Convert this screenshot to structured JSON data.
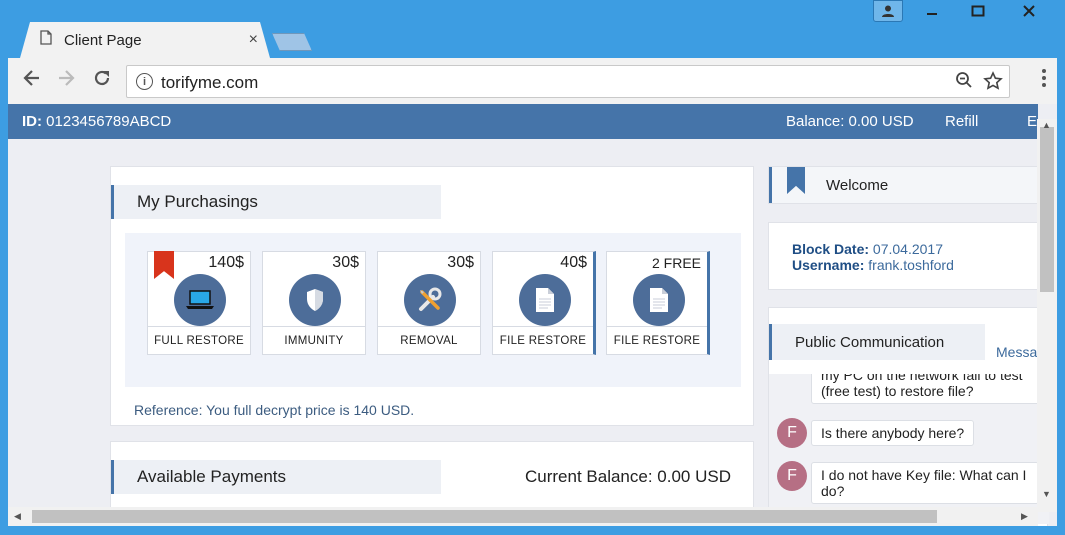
{
  "browser": {
    "tab_title": "Client Page",
    "tab_close": "×",
    "url": "torifyme.com",
    "icons": {
      "back": "back-arrow-icon",
      "forward": "forward-arrow-icon",
      "reload": "reload-icon",
      "info": "info-icon",
      "zoom": "zoom-out-icon",
      "star": "bookmark-star-icon",
      "menu": "kebab-menu-icon"
    }
  },
  "topbar": {
    "id_label": "ID:",
    "id_value": "0123456789ABCD",
    "balance": "Balance: 0.00 USD",
    "refill": "Refill",
    "more": "E"
  },
  "purchasings": {
    "title": "My Purchasings",
    "products": [
      {
        "price": "140$",
        "label": "FULL RESTORE",
        "icon": "laptop-icon"
      },
      {
        "price": "30$",
        "label": "IMMUNITY",
        "icon": "shield-icon"
      },
      {
        "price": "30$",
        "label": "REMOVAL",
        "icon": "tools-icon"
      },
      {
        "price": "40$",
        "label": "FILE RESTORE",
        "icon": "file-icon"
      },
      {
        "price": "2 FREE",
        "label": "FILE RESTORE",
        "icon": "file-icon"
      }
    ],
    "reference": "Reference: You full decrypt price is 140 USD."
  },
  "payments": {
    "title": "Available Payments",
    "current_balance": "Current Balance: 0.00 USD"
  },
  "welcome": {
    "title": "Welcome",
    "block_date_label": "Block Date",
    "block_date_value": "07.04.2017",
    "username_label": "Username",
    "username_value": "frank.toshford"
  },
  "communication": {
    "title": "Public Communication",
    "tab_partial": "Messa",
    "messages": [
      {
        "author": "",
        "text": "my PC on the network fail to test (free test) to restore file?"
      },
      {
        "author": "F",
        "text": "Is there anybody here?"
      },
      {
        "author": "F",
        "text": "I do not have Key file: What can I do?"
      }
    ]
  },
  "colors": {
    "accent": "#4574a9",
    "ribbon": "#d8341c",
    "avatar": "#b66f84",
    "icon_circle": "#4d6d99"
  }
}
